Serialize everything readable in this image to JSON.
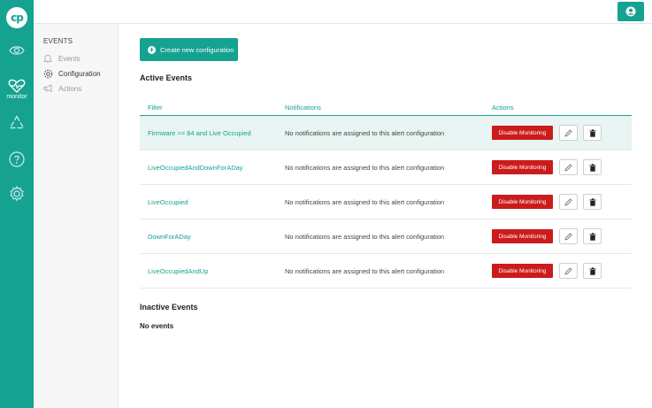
{
  "brand": {
    "logo_text": "cp"
  },
  "rail": {
    "items": [
      {
        "name": "eye",
        "label": ""
      },
      {
        "name": "monitor",
        "label": "monitor"
      },
      {
        "name": "recycle",
        "label": ""
      },
      {
        "name": "help",
        "label": ""
      },
      {
        "name": "settings",
        "label": ""
      }
    ]
  },
  "submenu": {
    "title": "EVENTS",
    "items": [
      {
        "label": "Events",
        "icon": "bell-icon",
        "active": false
      },
      {
        "label": "Configuration",
        "icon": "gear-icon",
        "active": true
      },
      {
        "label": "Actions",
        "icon": "megaphone-icon",
        "active": false
      }
    ]
  },
  "main": {
    "create_label": "Create new configuration",
    "active_title": "Active Events",
    "columns": {
      "filter": "Filter",
      "notifications": "Notifications",
      "actions": "Actions"
    },
    "rows": [
      {
        "filter": "Firmware >= 84 and Live Occupied",
        "notifications": "No notifications are assigned to this alert configuration",
        "action": "Disable Monitoring"
      },
      {
        "filter": "LiveOccupiedAndDownForADay",
        "notifications": "No notifications are assigned to this alert configuration",
        "action": "Disable Monitoring"
      },
      {
        "filter": "LiveOccupied",
        "notifications": "No notifications are assigned to this alert configuration",
        "action": "Disable Monitoring"
      },
      {
        "filter": "DownForADay",
        "notifications": "No notifications are assigned to this alert configuration",
        "action": "Disable Monitoring"
      },
      {
        "filter": "LiveOccupiedAndUp",
        "notifications": "No notifications are assigned to this alert configuration",
        "action": "Disable Monitoring"
      }
    ],
    "inactive_title": "Inactive Events",
    "inactive_empty": "No events"
  },
  "colors": {
    "accent": "#16a291",
    "danger": "#cc1b1b",
    "highlight": "#e8f5f3"
  }
}
